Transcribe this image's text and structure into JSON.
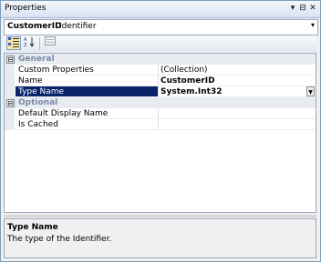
{
  "window": {
    "title": "Properties",
    "buttons": {
      "dropdown": "▾",
      "pin": "⊟",
      "close": "✕"
    }
  },
  "object_selector": {
    "name": "CustomerID",
    "type": "Identifier",
    "arrow": "▾"
  },
  "toolbar": {
    "categorized_icon": "categorized-icon",
    "alphabetical_icon": "alphabetical-icon",
    "property_pages_icon": "property-pages-icon"
  },
  "grid": {
    "categories": [
      {
        "label": "General",
        "toggle": "⊟",
        "properties": [
          {
            "name": "Custom Properties",
            "value": "(Collection)",
            "bold": false
          },
          {
            "name": "Name",
            "value": "CustomerID",
            "bold": true
          },
          {
            "name": "Type Name",
            "value": "System.Int32",
            "bold": true,
            "selected": true
          }
        ]
      },
      {
        "label": "Optional",
        "toggle": "⊟",
        "properties": [
          {
            "name": "Default Display Name",
            "value": "",
            "bold": false
          },
          {
            "name": "Is Cached",
            "value": "",
            "bold": false
          }
        ]
      }
    ]
  },
  "description": {
    "title": "Type Name",
    "text": "The type of the Identifier."
  },
  "colors": {
    "selection": "#0a246a",
    "category_text": "#7a8aa8",
    "border": "#7f9db9"
  }
}
